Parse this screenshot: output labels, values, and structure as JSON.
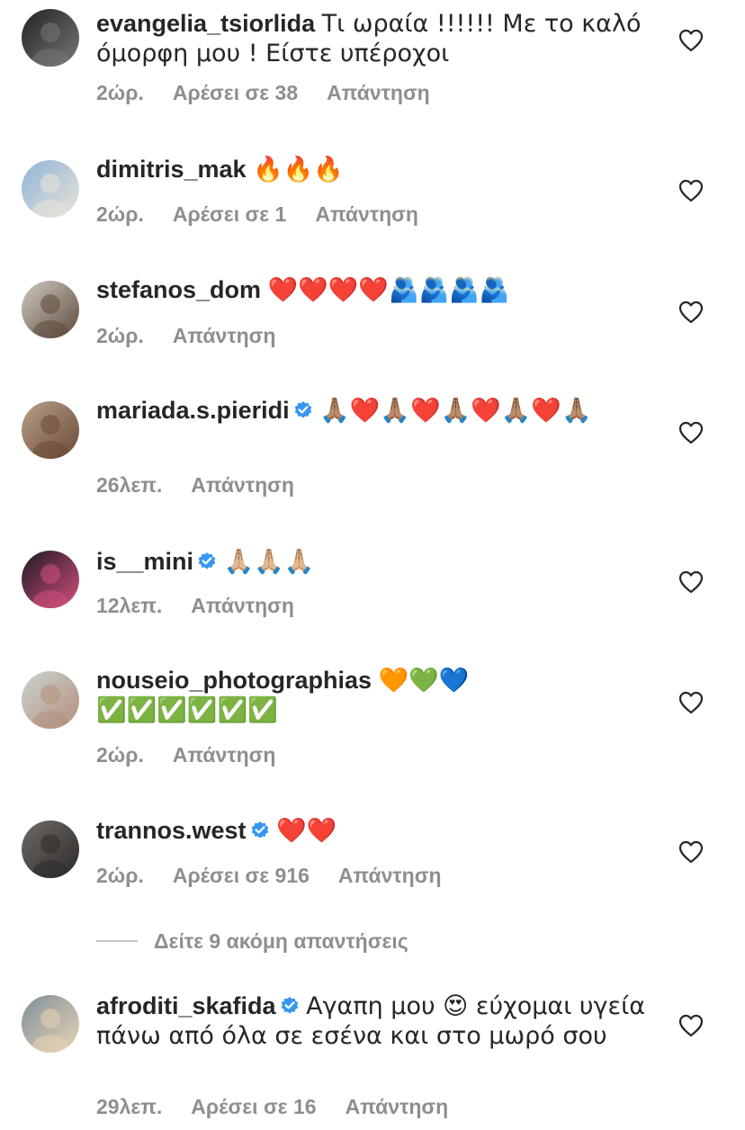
{
  "comments": [
    {
      "username": "evangelia_tsiorlida",
      "verified": false,
      "text": "Τι ωραία !!!!!! Με το καλό όμορφη μου ! Είστε υπέροχοι",
      "time": "2ώρ.",
      "likes": "Αρέσει σε 38",
      "reply": "Απάντηση",
      "avatar_colors": [
        "#222222",
        "#777777"
      ]
    },
    {
      "username": "dimitris_mak",
      "verified": false,
      "text": "🔥🔥🔥",
      "time": "2ώρ.",
      "likes": "Αρέσει σε 1",
      "reply": "Απάντηση",
      "avatar_colors": [
        "#8fb3d6",
        "#e9e4da"
      ]
    },
    {
      "username": "stefanos_dom",
      "verified": false,
      "text": "❤️❤️❤️❤️🫂🫂🫂🫂",
      "time": "2ώρ.",
      "likes": "",
      "reply": "Απάντηση",
      "avatar_colors": [
        "#cfcac2",
        "#5d4a3c"
      ]
    },
    {
      "username": "mariada.s.pieridi",
      "verified": true,
      "text": "🙏🏽❤️🙏🏽❤️🙏🏽❤️🙏🏽❤️🙏🏽",
      "time": "26λεπ.",
      "likes": "",
      "reply": "Απάντηση",
      "avatar_colors": [
        "#b7a08a",
        "#6b4a36"
      ]
    },
    {
      "username": "is__mini",
      "verified": true,
      "text": "🙏🏼🙏🏼🙏🏼",
      "time": "12λεπ.",
      "likes": "",
      "reply": "Απάντηση",
      "avatar_colors": [
        "#1d1a24",
        "#d24f7d"
      ]
    },
    {
      "username": "nouseio_photographias",
      "verified": false,
      "text": "🧡💚💙 ✅✅✅✅✅✅",
      "time": "2ώρ.",
      "likes": "",
      "reply": "Απάντηση",
      "avatar_colors": [
        "#c9d3cf",
        "#b58f7c"
      ]
    },
    {
      "username": "trannos.west",
      "verified": true,
      "text": "❤️❤️",
      "time": "2ώρ.",
      "likes": "Αρέσει σε 916",
      "reply": "Απάντηση",
      "avatar_colors": [
        "#6f6a66",
        "#2d2b2a"
      ]
    },
    {
      "username": "afroditi_skafida",
      "verified": true,
      "text": "Αγαπη μου 😍 εύχομαι υγεία πάνω από όλα σε εσένα και στο μωρό σου",
      "time": "29λεπ.",
      "likes": "Αρέσει σε 16",
      "reply": "Απάντηση",
      "avatar_colors": [
        "#7d8f9a",
        "#e8d4b4"
      ]
    }
  ],
  "more_replies": {
    "label": "Δείτε 9 ακόμη απαντήσεις"
  },
  "colors": {
    "text": "#262626",
    "meta": "#8e8e8e",
    "verified": "#3897f0"
  }
}
